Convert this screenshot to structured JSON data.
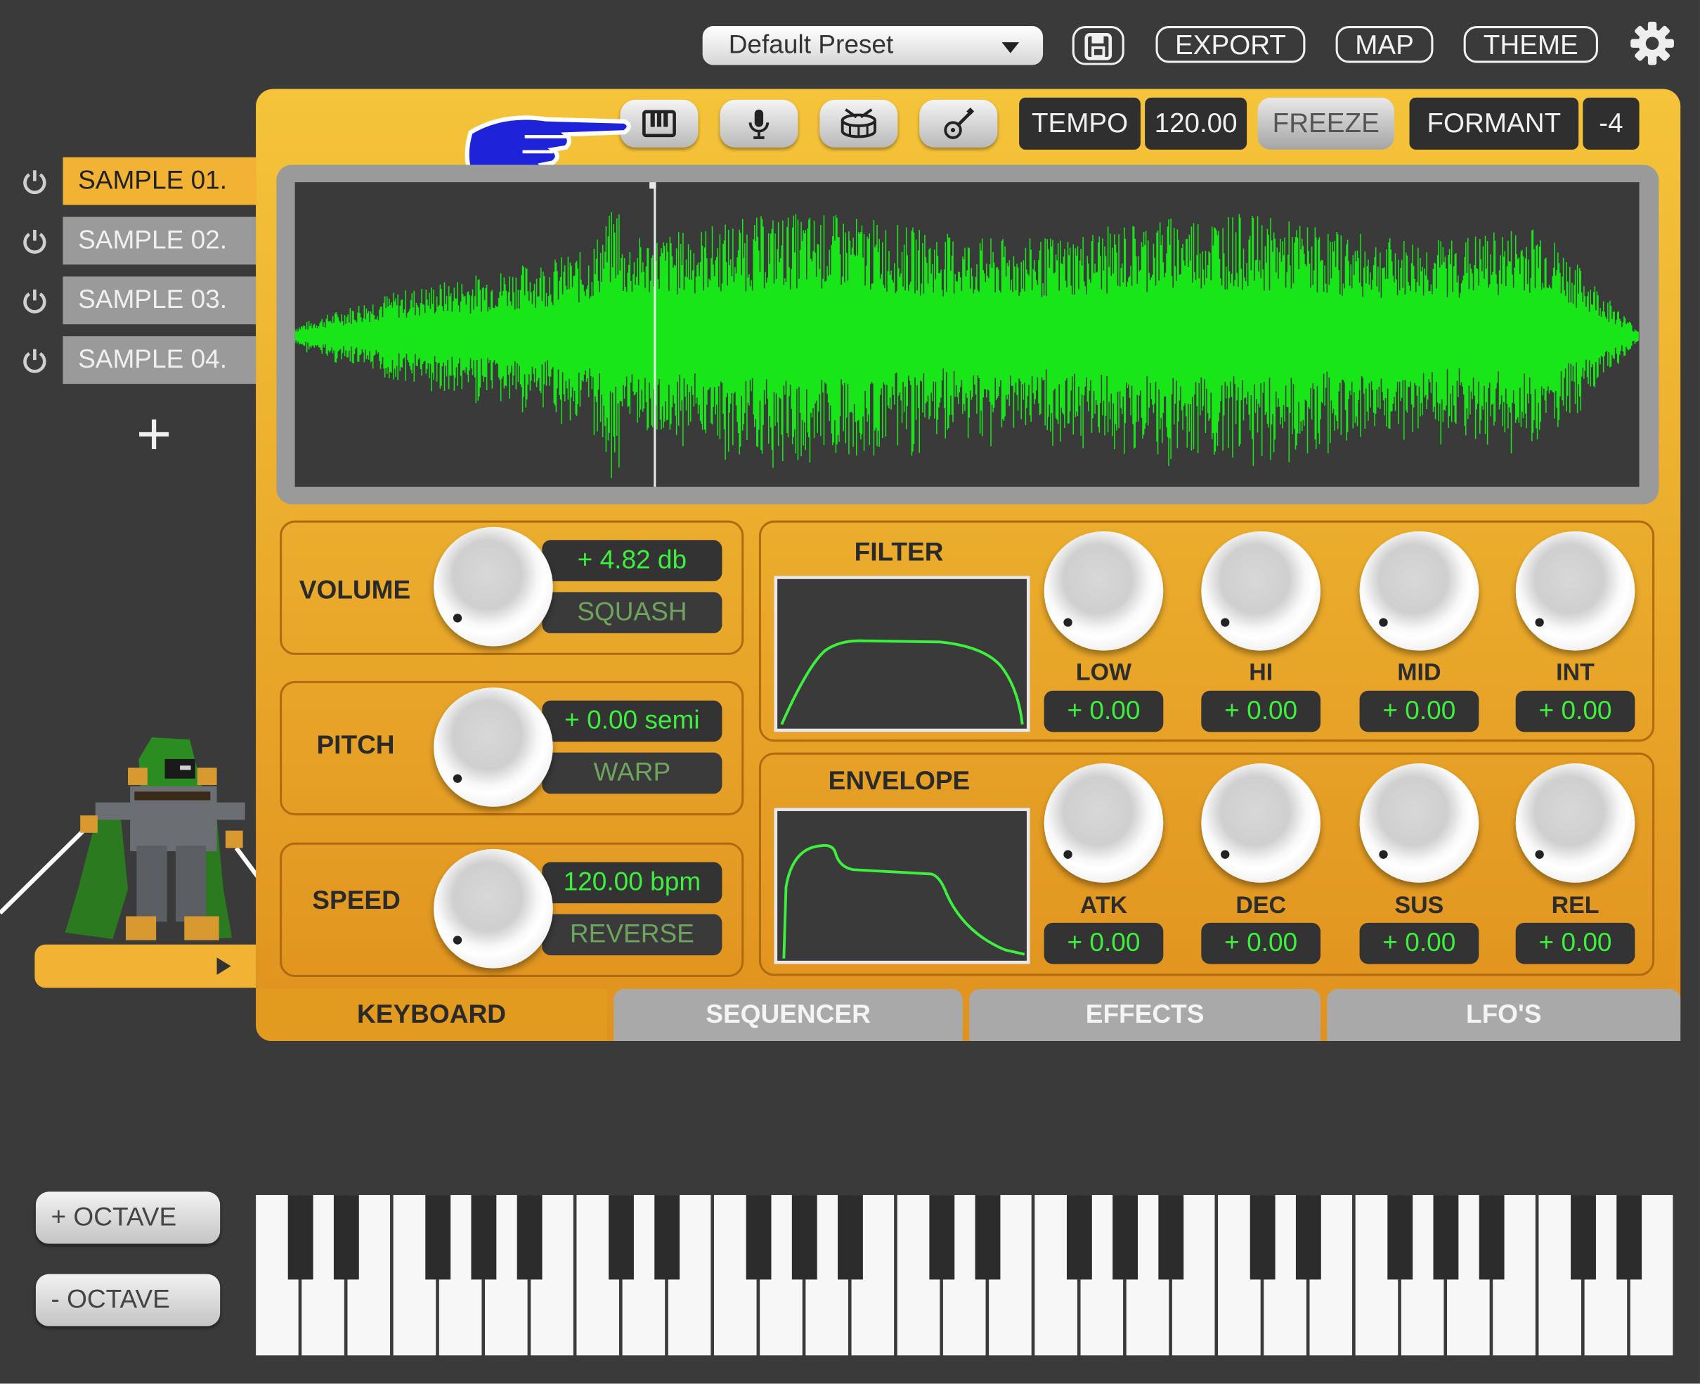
{
  "header": {
    "preset": "Default Preset",
    "export_label": "EXPORT",
    "map_label": "MAP",
    "theme_label": "THEME"
  },
  "toolbar": {
    "icons": [
      "keyboard-icon",
      "microphone-icon",
      "drum-icon",
      "guitar-icon"
    ],
    "tempo_label": "TEMPO",
    "tempo_value": "120.00",
    "freeze_label": "FREEZE",
    "formant_label": "FORMANT",
    "formant_value": "-4"
  },
  "samples": {
    "items": [
      "SAMPLE 01.",
      "SAMPLE 02.",
      "SAMPLE 03.",
      "SAMPLE 04."
    ],
    "selected": 0,
    "add_label": "+"
  },
  "controls": {
    "volume": {
      "label": "VOLUME",
      "value": "+ 4.82 db",
      "sub": "SQUASH"
    },
    "pitch": {
      "label": "PITCH",
      "value": "+ 0.00 semi",
      "sub": "WARP"
    },
    "speed": {
      "label": "SPEED",
      "value": "120.00 bpm",
      "sub": "REVERSE"
    }
  },
  "filter": {
    "title": "FILTER",
    "knobs": [
      {
        "label": "LOW",
        "value": "+ 0.00"
      },
      {
        "label": "HI",
        "value": "+ 0.00"
      },
      {
        "label": "MID",
        "value": "+ 0.00"
      },
      {
        "label": "INT",
        "value": "+ 0.00"
      }
    ]
  },
  "envelope": {
    "title": "ENVELOPE",
    "knobs": [
      {
        "label": "ATK",
        "value": "+ 0.00"
      },
      {
        "label": "DEC",
        "value": "+ 0.00"
      },
      {
        "label": "SUS",
        "value": "+ 0.00"
      },
      {
        "label": "REL",
        "value": "+ 0.00"
      }
    ]
  },
  "tabs": [
    "KEYBOARD",
    "SEQUENCER",
    "EFFECTS",
    "LFO'S"
  ],
  "active_tab": 0,
  "octave": {
    "up": "+ OCTAVE",
    "down": "- OCTAVE"
  },
  "colors": {
    "accent": "#f2b233",
    "wave": "#19e619",
    "panel_dark": "#3a3a3a",
    "pointer": "#1e22d8"
  }
}
